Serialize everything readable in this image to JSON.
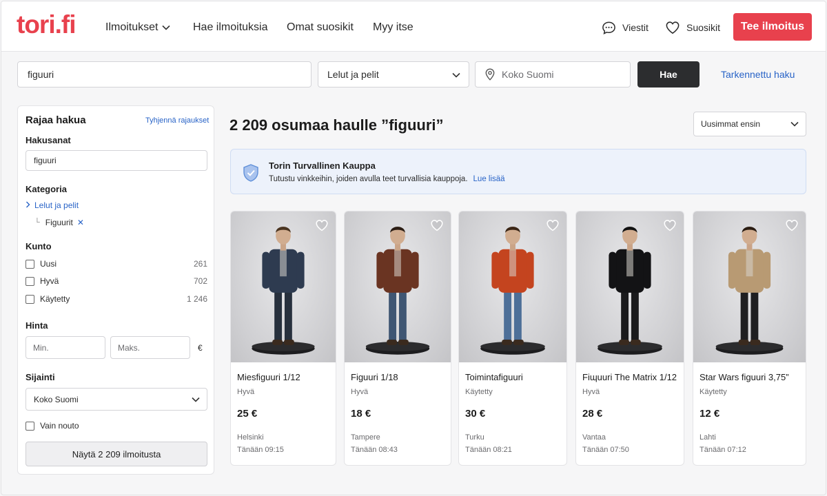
{
  "header": {
    "logo": "tori.fi",
    "nav": [
      "Ilmoitukset",
      "Hae ilmoituksia",
      "Omat suosikit",
      "Myy itse"
    ],
    "messages": "Viestit",
    "favorites": "Suosikit",
    "cta": "Tee ilmoitus",
    "brand_color": "#e8414d"
  },
  "search": {
    "query": "figuuri",
    "category": "Lelut ja pelit",
    "location": "Koko Suomi",
    "submit": "Hae",
    "advanced": "Tarkennettu haku"
  },
  "sidebar": {
    "title": "Rajaa hakua",
    "clear": "Tyhjennä rajaukset",
    "keywords_label": "Hakusanat",
    "keywords_value": "figuuri",
    "category_label": "Kategoria",
    "category_parent": "Lelut ja pelit",
    "category_child": "Figuurit",
    "condition_label": "Kunto",
    "conditions": [
      {
        "label": "Uusi",
        "count": "261"
      },
      {
        "label": "Hyvä",
        "count": "702"
      },
      {
        "label": "Käytetty",
        "count": "1 246"
      }
    ],
    "price_label": "Hinta",
    "price_min": "Min.",
    "price_max": "Maks.",
    "currency": "€",
    "location_label": "Sijainti",
    "location_value": "Koko Suomi",
    "pickup": "Vain nouto",
    "show_button": "Näytä 2 209 ilmoitusta"
  },
  "main": {
    "title": "2 209 osumaa haulle ”figuuri”",
    "sort": "Uusimmat ensin",
    "notice_title": "Torin Turvallinen Kauppa",
    "notice_text": "Tutustu vinkkeihin, joiden avulla teet turvallisia kauppoja.",
    "notice_link": "Lue lisää"
  },
  "listings": [
    {
      "title": "Miesfiguuri 1/12",
      "condition": "Hyvä",
      "price": "25 €",
      "city": "Helsinki",
      "time": "Tänään 09:15",
      "jacket": "#2e3b50",
      "pants": "#27303d",
      "hair": "#4a3420"
    },
    {
      "title": "Figuuri 1/18",
      "condition": "Hyvä",
      "price": "18 €",
      "city": "Tampere",
      "time": "Tänään 08:43",
      "jacket": "#6a3422",
      "pants": "#3f5673",
      "hair": "#2b1d14"
    },
    {
      "title": "Toimintafiguuri",
      "condition": "Käytetty",
      "price": "30 €",
      "city": "Turku",
      "time": "Tänään 08:21",
      "jacket": "#c4441f",
      "pants": "#4d6f98",
      "hair": "#3b2616"
    },
    {
      "title": "Fiɰuuri The Matrix 1/12",
      "condition": "Hyvä",
      "price": "28 €",
      "city": "Vantaa",
      "time": "Tänään 07:50",
      "jacket": "#131315",
      "pants": "#1a1a1c",
      "hair": "#111111"
    },
    {
      "title": "Star Wars figuuri 3,75”",
      "condition": "Käytetty",
      "price": "12 €",
      "city": "Lahti",
      "time": "Tänään 07:12",
      "jacket": "#b89a73",
      "pants": "#1f1f21",
      "hair": "#2a1c12"
    }
  ]
}
